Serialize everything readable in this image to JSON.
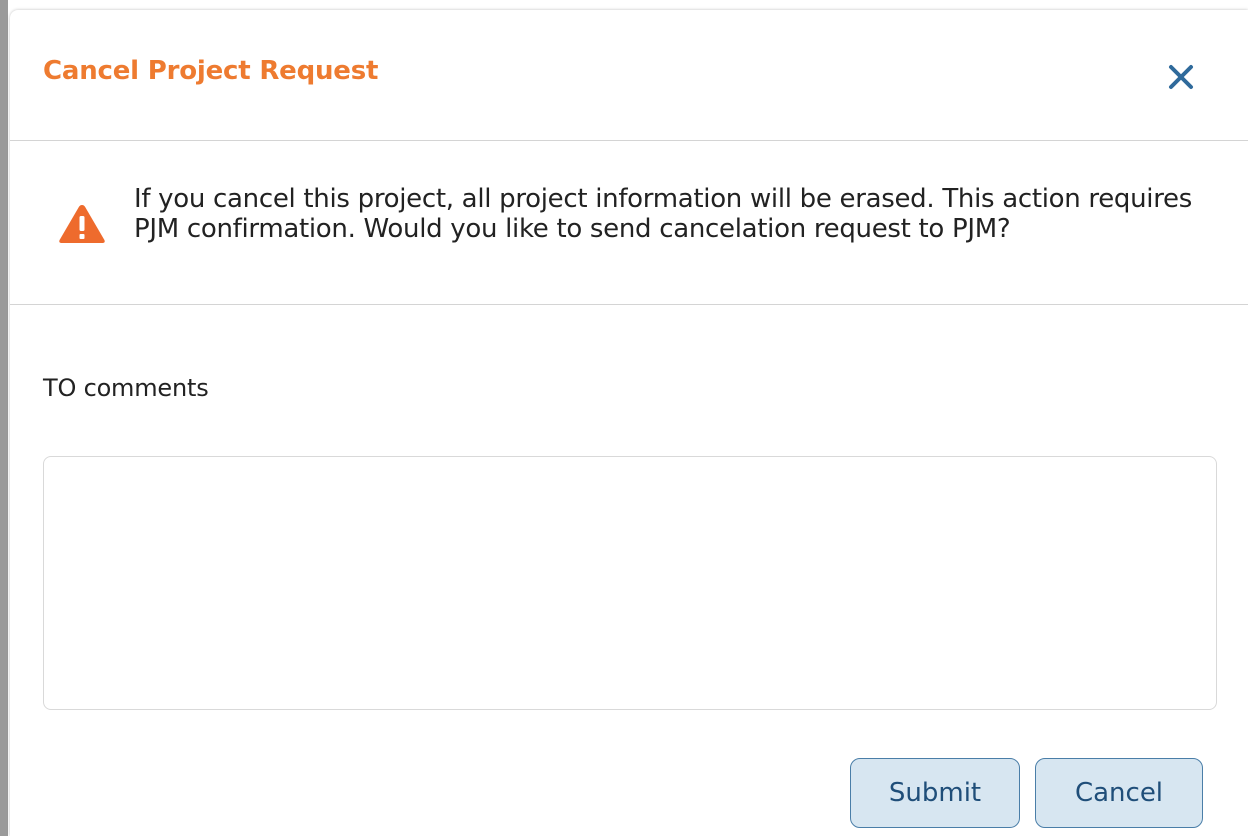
{
  "dialog": {
    "title": "Cancel Project Request",
    "close_icon": "close-icon",
    "title_color": "#ee7b30",
    "close_color": "#2f6a9b"
  },
  "warning": {
    "icon": "warning-triangle-icon",
    "icon_color": "#ee6b2d",
    "message": "If you cancel this project, all project information will be erased. This action requires PJM confirmation. Would you like to send cancelation request to PJM?"
  },
  "comments": {
    "label": "TO comments",
    "value": "",
    "placeholder": ""
  },
  "buttons": {
    "submit_label": "Submit",
    "cancel_label": "Cancel",
    "button_bg": "#d7e6f1",
    "button_border": "#4a7ea8"
  }
}
